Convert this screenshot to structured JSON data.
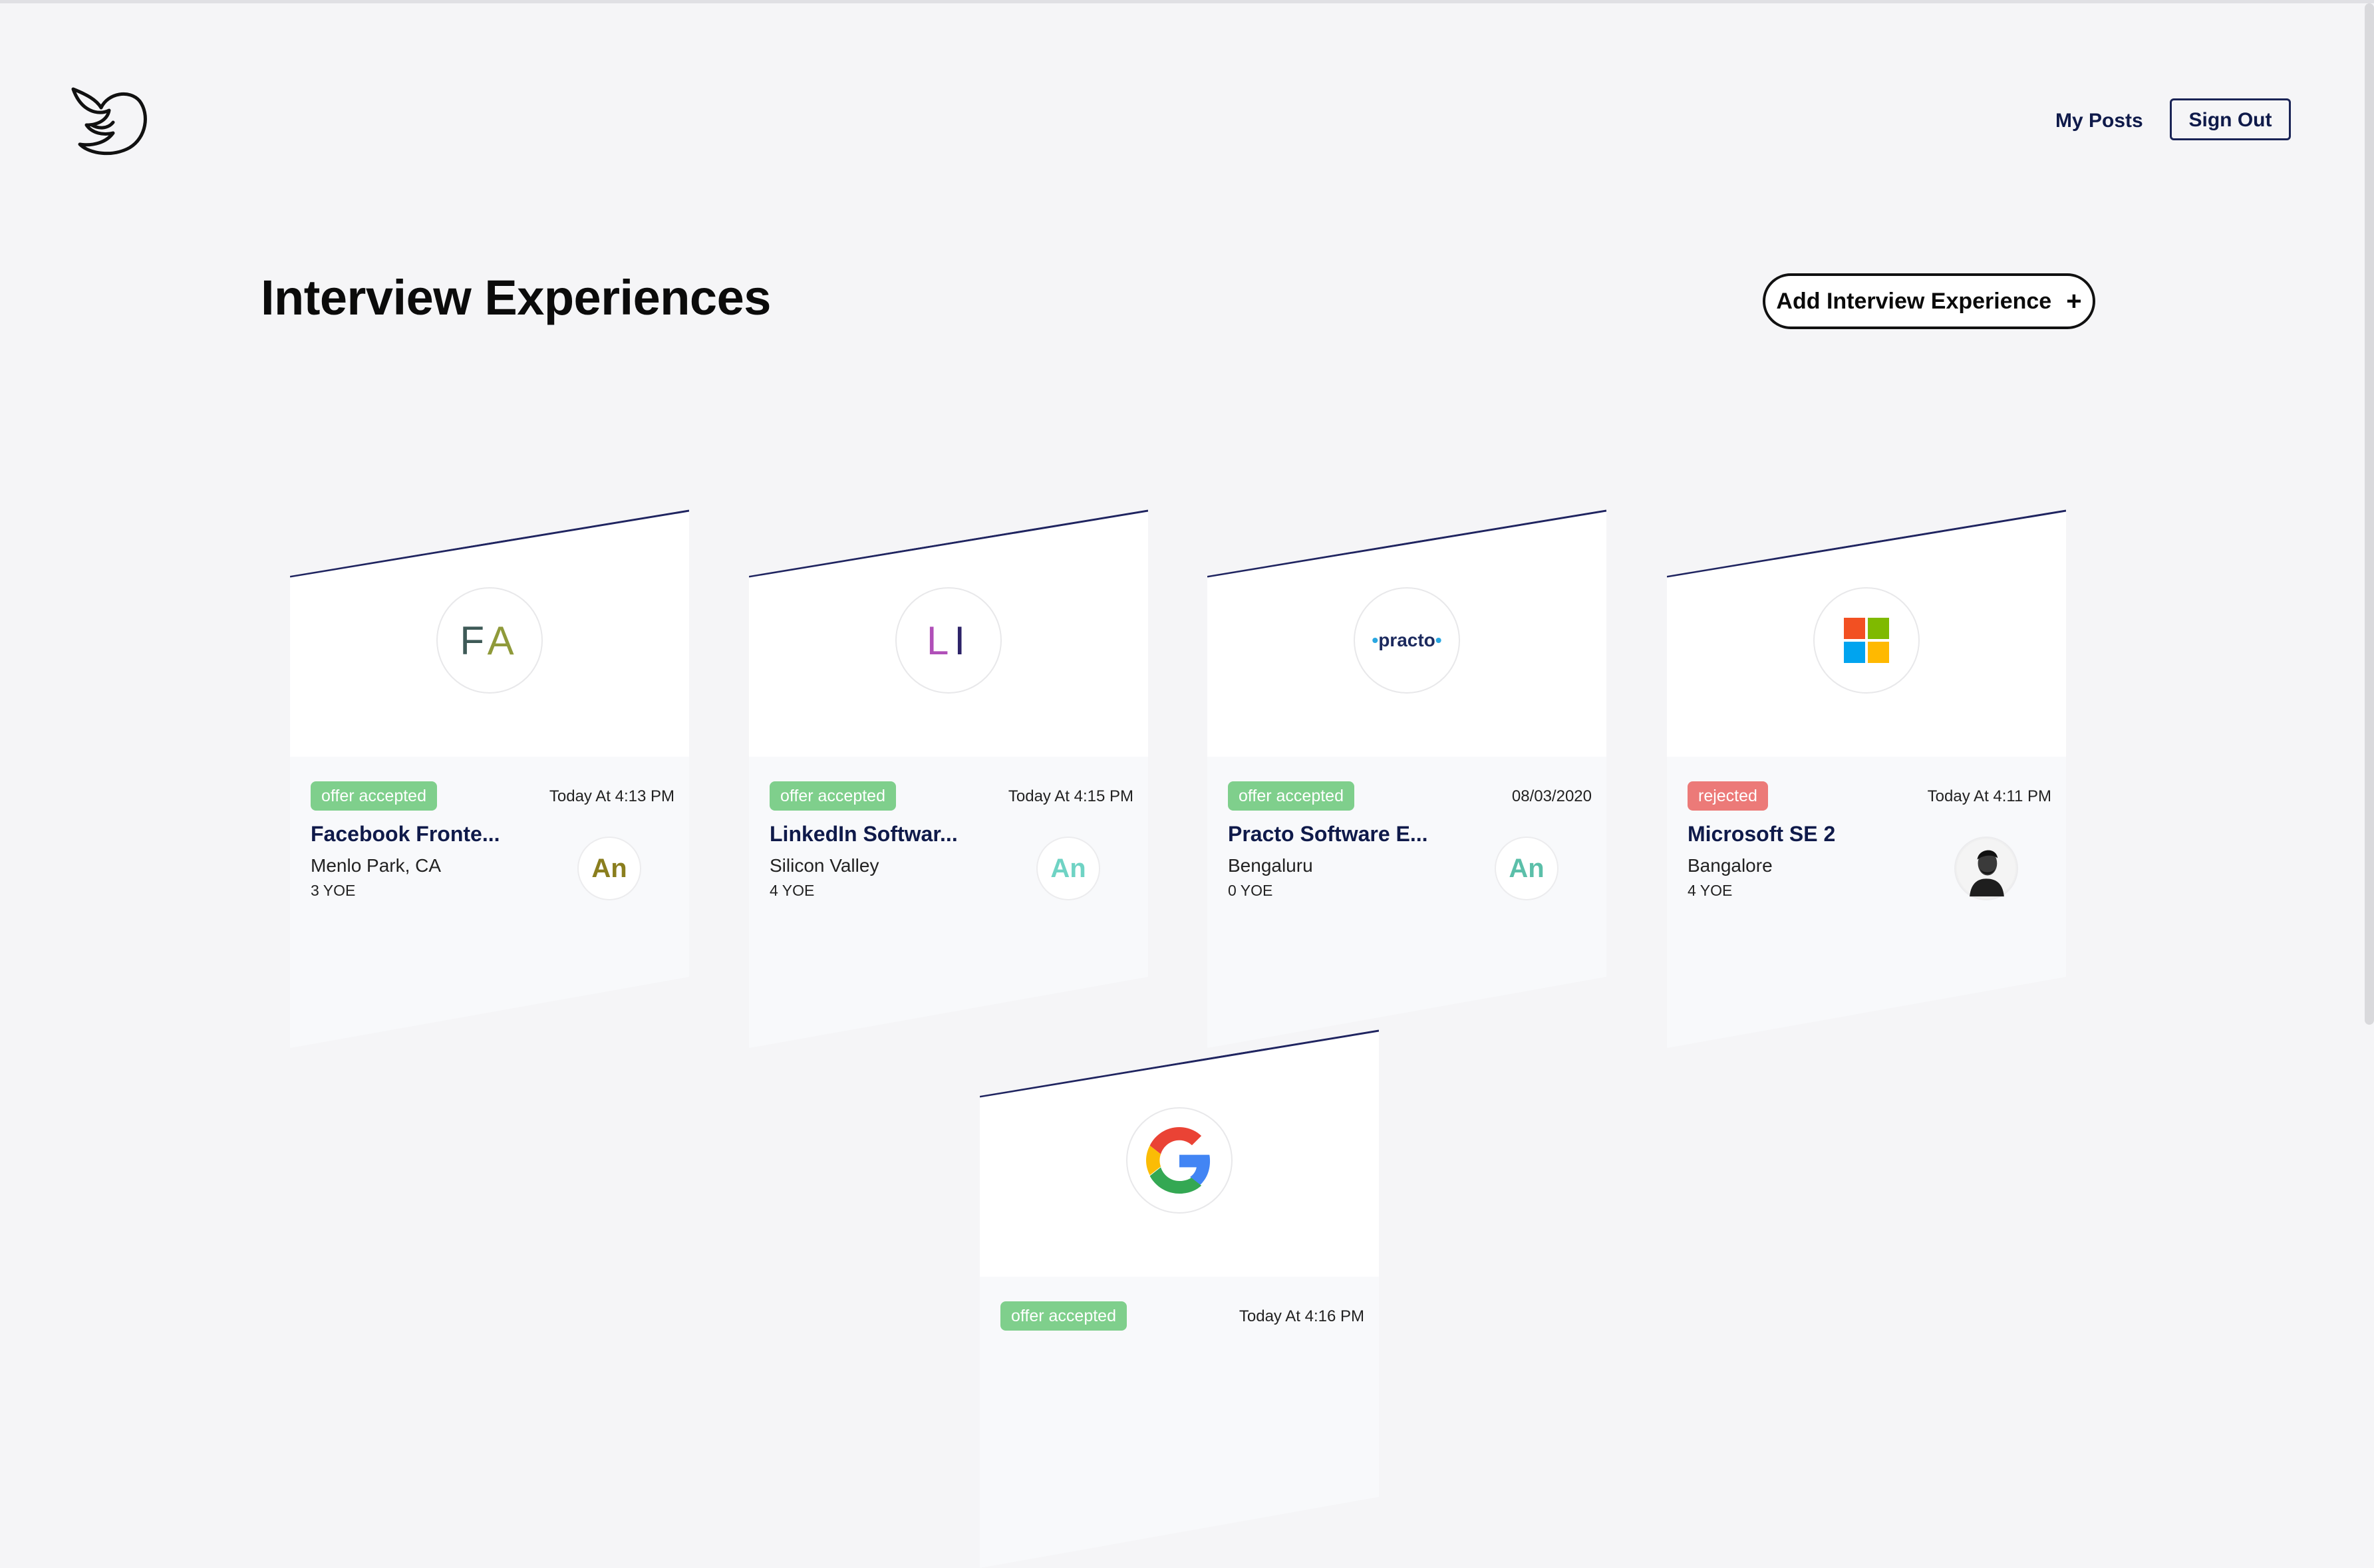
{
  "header": {
    "nav_my_posts": "My Posts",
    "sign_out": "Sign Out"
  },
  "page": {
    "title": "Interview Experiences",
    "add_button_label": "Add Interview Experience",
    "add_button_icon": "plus-icon"
  },
  "colors": {
    "accepted": "#7fcf8c",
    "rejected": "#ec7a78",
    "title_navy": "#0f1a4a"
  },
  "cards": [
    {
      "logo_type": "initials",
      "initials": [
        "F",
        "A"
      ],
      "initial_colors": [
        "#3e5a57",
        "#8f9a3a"
      ],
      "status": "offer accepted",
      "date": "Today At 4:13 PM",
      "title": "Facebook Fronte...",
      "location": "Menlo Park, CA",
      "yoe": "3 YOE",
      "avatar": "An",
      "avatar_color": "#8a7e1e"
    },
    {
      "logo_type": "initials",
      "initials": [
        "L",
        "I"
      ],
      "initial_colors": [
        "#b04fb8",
        "#2d2368"
      ],
      "status": "offer accepted",
      "date": "Today At 4:15 PM",
      "title": "LinkedIn Softwar...",
      "location": "Silicon Valley",
      "yoe": "4 YOE",
      "avatar": "An",
      "avatar_color": "#6fd3c4"
    },
    {
      "logo_type": "practo",
      "logo_text": "practo",
      "status": "offer accepted",
      "date": "08/03/2020",
      "title": "Practo Software E...",
      "location": "Bengaluru",
      "yoe": "0 YOE",
      "avatar": "An",
      "avatar_color": "#5bbfa9"
    },
    {
      "logo_type": "microsoft-icon",
      "status": "rejected",
      "date": "Today At 4:11 PM",
      "title": "Microsoft SE 2",
      "location": "Bangalore",
      "yoe": "4 YOE",
      "avatar": "photo",
      "avatar_color": "#222222"
    },
    {
      "logo_type": "google-icon",
      "status": "offer accepted",
      "date": "Today At 4:16 PM",
      "title": "",
      "location": "",
      "yoe": "",
      "avatar": "",
      "avatar_color": "#888888"
    }
  ]
}
